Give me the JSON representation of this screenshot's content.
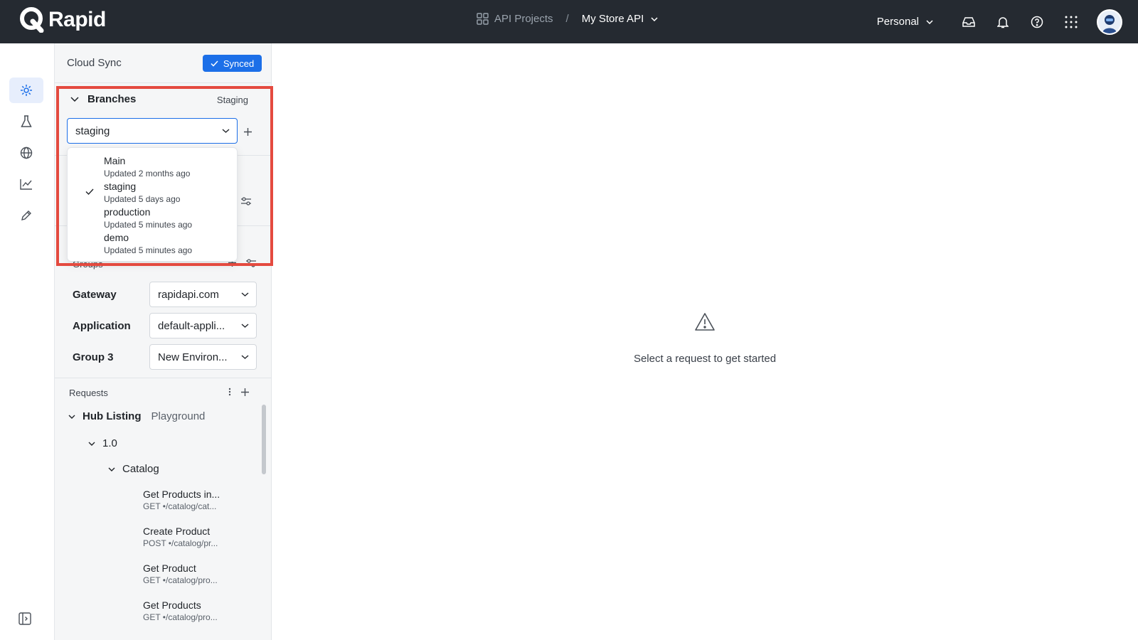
{
  "app": {
    "brand": "Rapid"
  },
  "header": {
    "projects_label": "API Projects",
    "separator": "/",
    "current_project": "My Store API",
    "workspace": "Personal"
  },
  "cloud_sync": {
    "label": "Cloud Sync",
    "status": "Synced"
  },
  "branches": {
    "title": "Branches",
    "current": "Staging",
    "select_value": "staging",
    "options": [
      {
        "name": "Main",
        "updated": "Updated 2 months ago",
        "selected": false
      },
      {
        "name": "staging",
        "updated": "Updated 5 days ago",
        "selected": true
      },
      {
        "name": "production",
        "updated": "Updated 5 minutes ago",
        "selected": false
      },
      {
        "name": "demo",
        "updated": "Updated 5 minutes ago",
        "selected": false
      }
    ]
  },
  "groups": {
    "label": "Groups",
    "rows": [
      {
        "label": "Gateway",
        "value": "rapidapi.com"
      },
      {
        "label": "Application",
        "value": "default-appli..."
      },
      {
        "label": "Group 3",
        "value": "New Environ..."
      }
    ]
  },
  "requests": {
    "label": "Requests",
    "tree": {
      "api": "Hub Listing",
      "api_sub": "Playground",
      "version": "1.0",
      "folder": "Catalog",
      "items": [
        {
          "title": "Get Products in...",
          "path": "GET •/catalog/cat..."
        },
        {
          "title": "Create Product",
          "path": "POST •/catalog/pr..."
        },
        {
          "title": "Get Product",
          "path": "GET •/catalog/pro..."
        },
        {
          "title": "Get Products",
          "path": "GET •/catalog/pro..."
        }
      ]
    }
  },
  "main": {
    "empty_message": "Select a request to get started"
  },
  "colors": {
    "accent": "#1c6fe8",
    "topbar": "#252a31",
    "highlight": "#e44a3f"
  }
}
